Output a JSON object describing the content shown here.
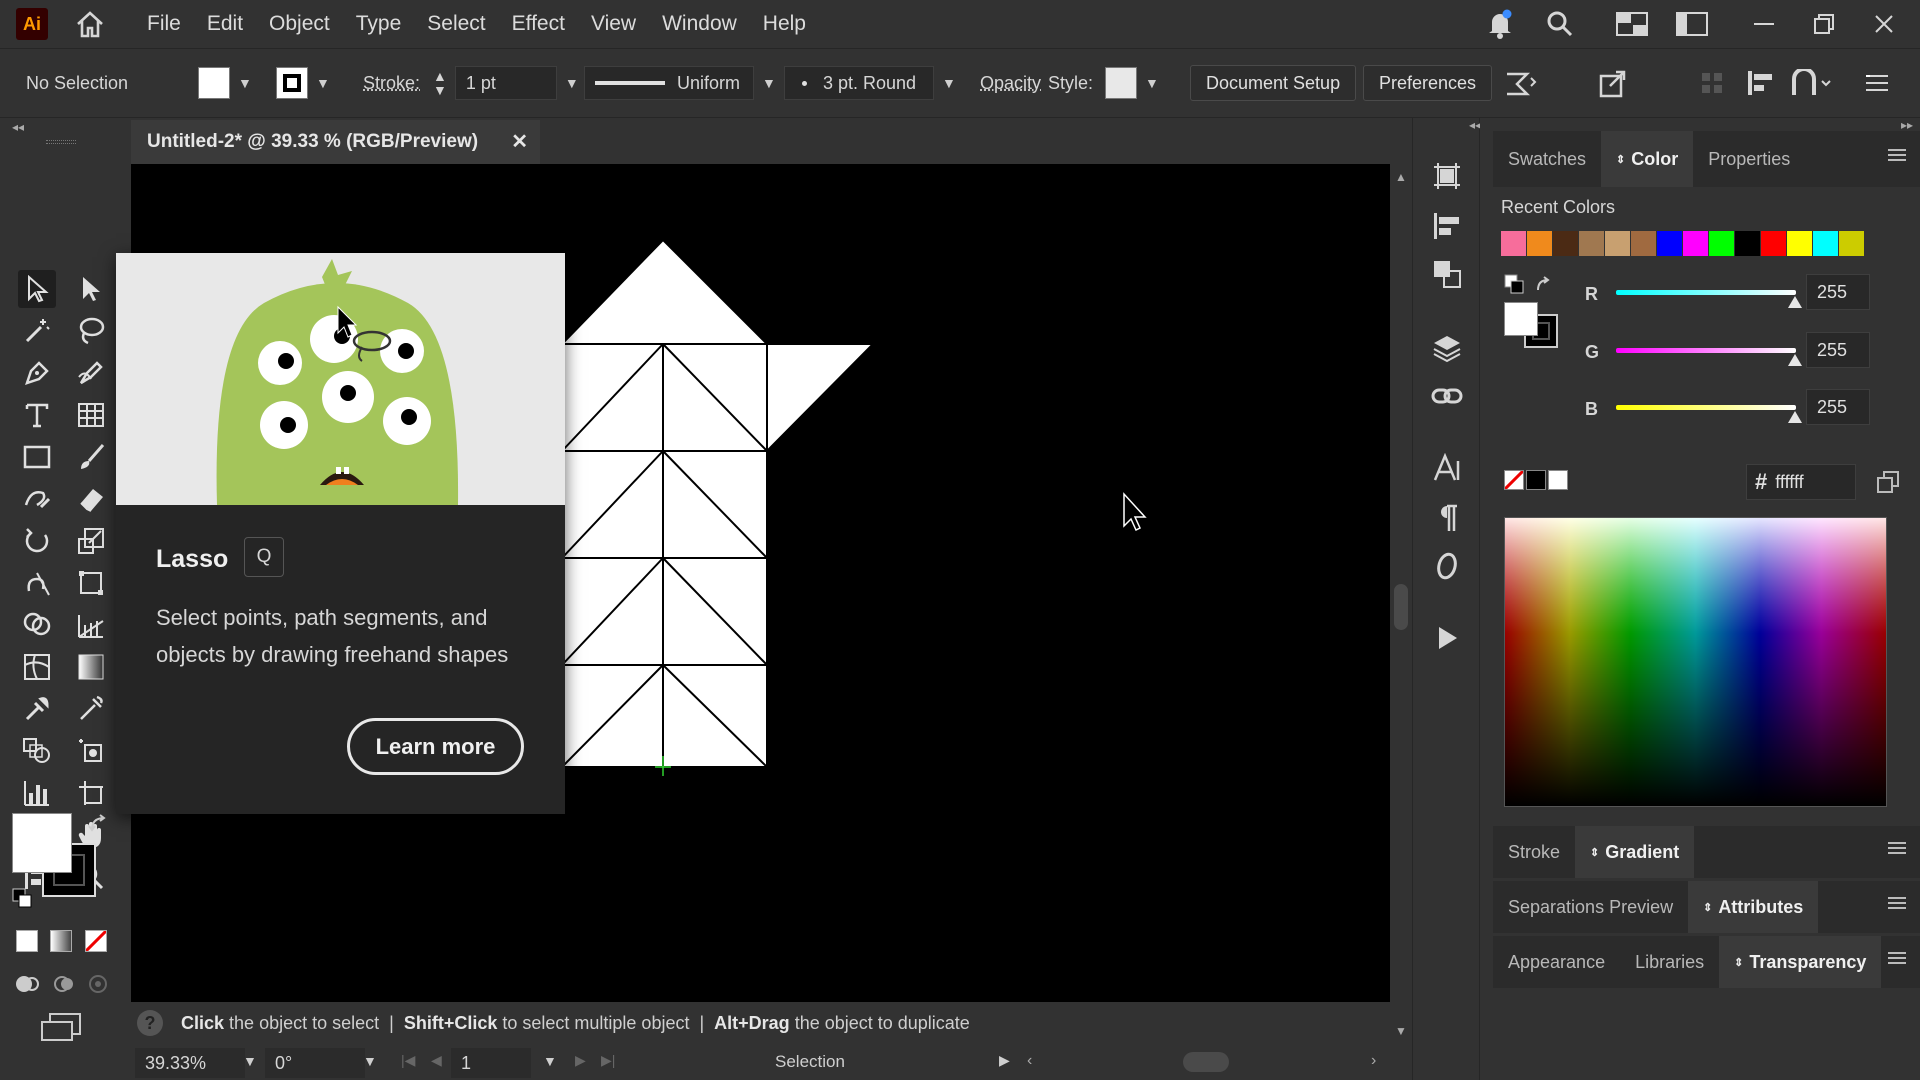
{
  "menubar": {
    "logo": "Ai",
    "items": [
      "File",
      "Edit",
      "Object",
      "Type",
      "Select",
      "Effect",
      "View",
      "Window",
      "Help"
    ]
  },
  "control": {
    "selection_state": "No Selection",
    "stroke_label": "Stroke:",
    "stroke_weight": "1 pt",
    "profile": "Uniform",
    "brush": "3 pt. Round",
    "opacity_label": "Opacity",
    "style_label": "Style:",
    "document_setup": "Document Setup",
    "preferences": "Preferences"
  },
  "document": {
    "tab_title": "Untitled-2* @ 39.33 % (RGB/Preview)",
    "close_glyph": "✕"
  },
  "tooltip": {
    "title": "Lasso",
    "shortcut": "Q",
    "description": "Select points, path segments, and objects by drawing freehand shapes",
    "learn_more": "Learn more"
  },
  "status": {
    "hint_1_key": "Click",
    "hint_1_text": "the object to select",
    "hint_2_key": "Shift+Click",
    "hint_2_text": "to select multiple object",
    "hint_3_key": "Alt+Drag",
    "hint_3_text": "the object to duplicate",
    "zoom": "39.33%",
    "rotation": "0°",
    "artboard": "1",
    "tool_name": "Selection"
  },
  "panel_top": {
    "tabs": [
      "Swatches",
      "Color",
      "Properties"
    ],
    "active": "Color",
    "recent_label": "Recent Colors",
    "recent_colors": [
      "#f76d9b",
      "#f08a1c",
      "#4b2a14",
      "#a07850",
      "#c8a070",
      "#a06a40",
      "#0000ff",
      "#ff00ff",
      "#00ff00",
      "#000000",
      "#ff0000",
      "#ffff00",
      "#00ffff",
      "#cccc00"
    ],
    "r_label": "R",
    "r_value": "255",
    "g_label": "G",
    "g_value": "255",
    "b_label": "B",
    "b_value": "255",
    "hex_symbol": "#",
    "hex_value": "ffffff"
  },
  "panel_stroke": {
    "tabs": [
      "Stroke",
      "Gradient"
    ]
  },
  "panel_sep": {
    "tabs": [
      "Separations Preview",
      "Attributes"
    ]
  },
  "panel_app": {
    "tabs": [
      "Appearance",
      "Libraries",
      "Transparency"
    ]
  }
}
